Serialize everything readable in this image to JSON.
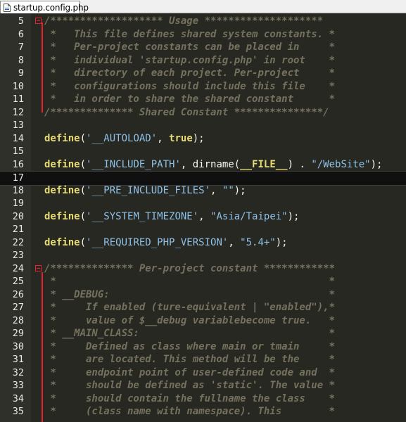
{
  "tab": {
    "filename": "startup.config.php"
  },
  "lines": [
    {
      "n": "5",
      "type": "comment",
      "text": "/******************* Usage ********************",
      "fold": true
    },
    {
      "n": "6",
      "type": "comment",
      "text": " *   This file defines shared system constants. *"
    },
    {
      "n": "7",
      "type": "comment",
      "text": " *   Per-project constants can be placed in     *"
    },
    {
      "n": "8",
      "type": "comment",
      "text": " *   individual 'startup.config.php' in root    *"
    },
    {
      "n": "9",
      "type": "comment",
      "text": " *   directory of each project. Per-project     *"
    },
    {
      "n": "10",
      "type": "comment",
      "text": " *   configurations should include this file    *"
    },
    {
      "n": "11",
      "type": "comment",
      "text": " *   in order to share the shared constant      *"
    },
    {
      "n": "12",
      "type": "comment",
      "text": "/************** Shared Constant ***************/"
    },
    {
      "n": "13",
      "type": "blank",
      "text": ""
    },
    {
      "n": "14",
      "type": "define",
      "kw": "define",
      "pre": "(",
      "str": "'__AUTOLOAD'",
      "mid": ", ",
      "val": "true",
      "post": ");"
    },
    {
      "n": "15",
      "type": "blank",
      "text": ""
    },
    {
      "n": "16",
      "type": "define16",
      "kw": "define",
      "pre": "(",
      "str": "'__INCLUDE_PATH'",
      "mid": ", dirname(",
      "magic": "__FILE__",
      "mid2": ") . ",
      "str2": "\"/WebSite\"",
      "post": ");"
    },
    {
      "n": "17",
      "type": "current",
      "text": ""
    },
    {
      "n": "18",
      "type": "define",
      "kw": "define",
      "pre": "(",
      "str": "'__PRE_INCLUDE_FILES'",
      "mid": ", ",
      "val2": "\"\"",
      "post": ");"
    },
    {
      "n": "19",
      "type": "blank",
      "text": ""
    },
    {
      "n": "20",
      "type": "define",
      "kw": "define",
      "pre": "(",
      "str": "'__SYSTEM_TIMEZONE'",
      "mid": ", ",
      "val2": "\"Asia/Taipei\"",
      "post": ");"
    },
    {
      "n": "21",
      "type": "blank",
      "text": ""
    },
    {
      "n": "22",
      "type": "define",
      "kw": "define",
      "pre": "(",
      "str": "'__REQUIRED_PHP_VERSION'",
      "mid": ", ",
      "val2": "\"5.4+\"",
      "post": ");"
    },
    {
      "n": "23",
      "type": "blank",
      "text": ""
    },
    {
      "n": "24",
      "type": "comment",
      "text": "/************** Per-project constant ************",
      "fold": true
    },
    {
      "n": "25",
      "type": "comment",
      "text": " *                                              *"
    },
    {
      "n": "26",
      "type": "comment",
      "text": " * __DEBUG:                                     *"
    },
    {
      "n": "27",
      "type": "comment",
      "text": " *     If enabled (ture-equivalent | \"enabled\"),*"
    },
    {
      "n": "28",
      "type": "comment",
      "text": " *     value of $__debug variablebecome true.   *"
    },
    {
      "n": "29",
      "type": "comment",
      "text": " * __MAIN_CLASS:                                *"
    },
    {
      "n": "30",
      "type": "comment",
      "text": " *     Defined as class where main or tmain     *"
    },
    {
      "n": "31",
      "type": "comment",
      "text": " *     are located. This method will be the     *"
    },
    {
      "n": "32",
      "type": "comment",
      "text": " *     endpoint point of user-defined code and  *"
    },
    {
      "n": "33",
      "type": "comment",
      "text": " *     should be defined as 'static'. The value *"
    },
    {
      "n": "34",
      "type": "comment",
      "text": " *     should contain the fullname the class    *"
    },
    {
      "n": "35",
      "type": "comment",
      "text": " *     (class name with namespace). This        *"
    }
  ]
}
